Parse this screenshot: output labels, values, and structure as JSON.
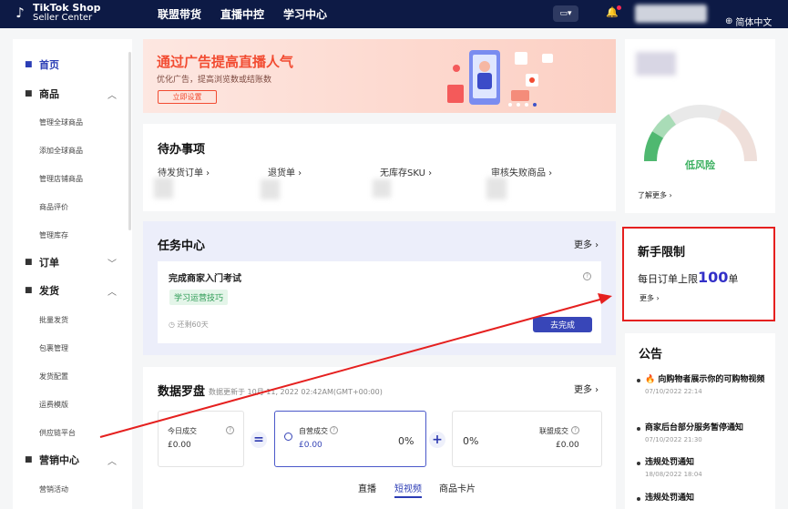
{
  "topbar": {
    "logo_line1": "TikTok Shop",
    "logo_line2": "Seller Center",
    "nav": [
      "联盟带货",
      "直播中控",
      "学习中心"
    ],
    "language": "简体中文"
  },
  "sidebar": {
    "items": [
      {
        "label": "首页",
        "icon": "home-icon",
        "level": "top",
        "active": true
      },
      {
        "label": "商品",
        "icon": "box-icon",
        "level": "top",
        "chevron": "up"
      },
      {
        "label": "管理全球商品",
        "level": "sub"
      },
      {
        "label": "添加全球商品",
        "level": "sub"
      },
      {
        "label": "管理店铺商品",
        "level": "sub"
      },
      {
        "label": "商品评价",
        "level": "sub"
      },
      {
        "label": "管理库存",
        "level": "sub"
      },
      {
        "label": "订单",
        "icon": "order-icon",
        "level": "top",
        "chevron": "down"
      },
      {
        "label": "发货",
        "icon": "truck-icon",
        "level": "top",
        "chevron": "up"
      },
      {
        "label": "批量发货",
        "level": "sub"
      },
      {
        "label": "包裹管理",
        "level": "sub"
      },
      {
        "label": "发货配置",
        "level": "sub"
      },
      {
        "label": "运费模版",
        "level": "sub"
      },
      {
        "label": "供应链平台",
        "level": "sub"
      },
      {
        "label": "营销中心",
        "icon": "marketing-icon",
        "level": "top",
        "chevron": "up"
      },
      {
        "label": "营销活动",
        "level": "sub"
      }
    ]
  },
  "banner": {
    "title": "通过广告提高直播人气",
    "subtitle": "优化广告，提高浏览数或结账数",
    "button": "立即设置"
  },
  "todo": {
    "title": "待办事项",
    "items": [
      "待发货订单 ›",
      "退货单 ›",
      "无库存SKU ›",
      "审核失败商品 ›"
    ]
  },
  "task_center": {
    "title": "任务中心",
    "more": "更多 ›",
    "task_title": "完成商家入门考试",
    "tag": "学习运营技巧",
    "remaining": "还剩60天",
    "action": "去完成"
  },
  "compass": {
    "title": "数据罗盘",
    "updated": "数据更新于 10月 11, 2022 02:42AM(GMT+00:00)",
    "more": "更多 ›",
    "metrics": [
      {
        "label": "今日成交",
        "value": "£0.00"
      },
      {
        "label": "自营成交",
        "value": "£0.00",
        "percent": "0%"
      },
      {
        "label": "联盟成交",
        "value": "£0.00",
        "percent": "0%"
      }
    ],
    "ops": [
      "=",
      "+"
    ],
    "tabs": [
      "直播",
      "短视频",
      "商品卡片"
    ],
    "active_tab": "短视频"
  },
  "risk": {
    "level": "低风险",
    "more": "了解更多 ›"
  },
  "limit": {
    "title": "新手限制",
    "text": "每日订单上限",
    "number": "100",
    "unit": "单",
    "more": "更多 ›"
  },
  "announcements": {
    "title": "公告",
    "items": [
      {
        "title": "🔥 向购物者展示你的可购物视频",
        "date": "07/10/2022 22:14"
      },
      {
        "title": "商家后台部分服务暂停通知",
        "date": "07/10/2022 21:30"
      },
      {
        "title": "违规处罚通知",
        "date": "18/08/2022 18:04"
      },
      {
        "title": "违规处罚通知",
        "date": ""
      }
    ]
  },
  "colors": {
    "topbar": "#0d1a45",
    "accent": "#2c3cb5",
    "banner_red": "#f24b31",
    "highlight_red": "#e5201f",
    "risk_green": "#3bb05f"
  }
}
